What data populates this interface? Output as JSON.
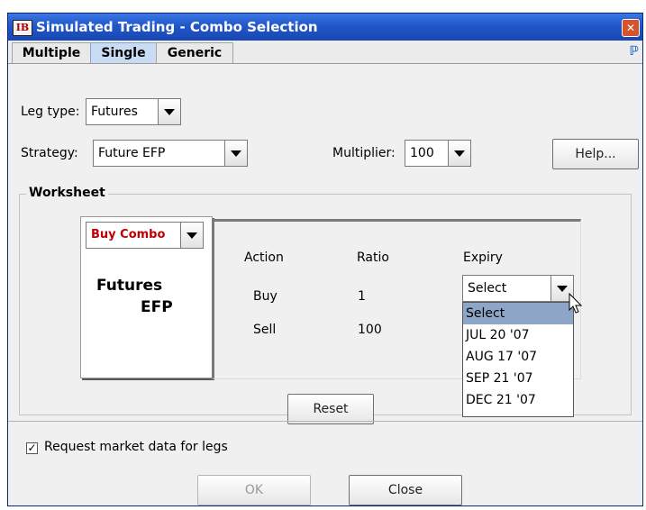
{
  "window": {
    "title": "Simulated Trading - Combo Selection",
    "icon_text": "IB"
  },
  "tabs": [
    "Multiple",
    "Single",
    "Generic"
  ],
  "active_tab": "Single",
  "leg_type": {
    "label": "Leg type:",
    "value": "Futures"
  },
  "strategy": {
    "label": "Strategy:",
    "value": "Future EFP"
  },
  "multiplier": {
    "label": "Multiplier:",
    "value": "100"
  },
  "help_button": "Help...",
  "worksheet": {
    "title": "Worksheet",
    "combo_action": "Buy Combo",
    "combo_name_line1": "Futures",
    "combo_name_line2": "EFP",
    "columns": [
      "Action",
      "Ratio",
      "Expiry"
    ],
    "rows": [
      {
        "action": "Buy",
        "ratio": "1"
      },
      {
        "action": "Sell",
        "ratio": "100"
      }
    ],
    "expiry_value": "Select",
    "expiry_options": [
      "Select",
      "JUL 20 '07",
      "AUG 17 '07",
      "SEP 21 '07",
      "DEC 21 '07"
    ],
    "reset_button": "Reset"
  },
  "request_market_data": {
    "label": "Request market data for legs",
    "checked": true
  },
  "ok_button": "OK",
  "close_button": "Close",
  "colors": {
    "title_bar": "#2157c9",
    "combo_action_text": "#c00000",
    "active_tab": "#c9dcf3",
    "dropdown_selection": "#8da6c8"
  }
}
